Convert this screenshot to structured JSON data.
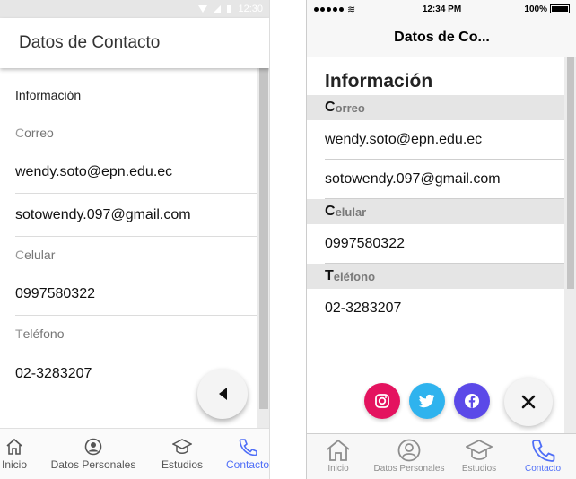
{
  "android": {
    "status": {
      "time": "12:30"
    },
    "toolbar": {
      "title": "Datos de Contacto"
    },
    "section_header": "Información",
    "dividers": {
      "correo": {
        "initial": "C",
        "rest": "orreo"
      },
      "celular": {
        "initial": "C",
        "rest": "elular"
      },
      "telefono": {
        "initial": "T",
        "rest": "eléfono"
      }
    },
    "items": {
      "email1": "wendy.soto@epn.edu.ec",
      "email2": "sotowendy.097@gmail.com",
      "cell": "0997580322",
      "phone": "02-3283207"
    },
    "fab_icon": "caret-back-icon",
    "tabs": [
      {
        "label": "Inicio",
        "icon": "home-icon"
      },
      {
        "label": "Datos Personales",
        "icon": "person-circle-icon"
      },
      {
        "label": "Estudios",
        "icon": "school-icon"
      },
      {
        "label": "Contacto",
        "icon": "call-icon",
        "active": true
      }
    ]
  },
  "ios": {
    "status": {
      "time": "12:34 PM",
      "battery": "100%"
    },
    "nav": {
      "title": "Datos de Co..."
    },
    "section_header": "Información",
    "dividers": {
      "correo": {
        "initial": "C",
        "rest": "orreo"
      },
      "celular": {
        "initial": "C",
        "rest": "elular"
      },
      "telefono": {
        "initial": "T",
        "rest": "eléfono"
      }
    },
    "items": {
      "email1": "wendy.soto@epn.edu.ec",
      "email2": "sotowendy.097@gmail.com",
      "cell": "0997580322",
      "phone": "02-3283207"
    },
    "social": [
      {
        "name": "instagram-icon",
        "color": "#e4135f"
      },
      {
        "name": "twitter-icon",
        "color": "#2fb3ee"
      },
      {
        "name": "facebook-icon",
        "color": "#5b49e8"
      }
    ],
    "close_icon": "close-icon",
    "tabs": [
      {
        "label": "Inicio",
        "icon": "home-icon"
      },
      {
        "label": "Datos Personales",
        "icon": "person-circle-icon"
      },
      {
        "label": "Estudios",
        "icon": "school-icon"
      },
      {
        "label": "Contacto",
        "icon": "call-icon",
        "active": true
      }
    ]
  },
  "colors": {
    "accent": "#4f6ef7"
  }
}
